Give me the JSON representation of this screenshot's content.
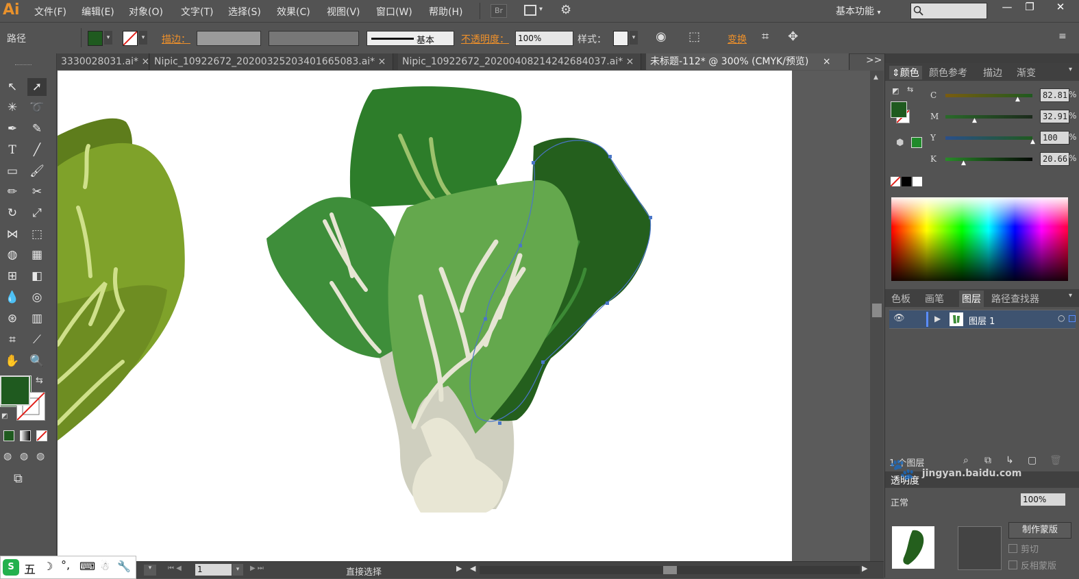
{
  "app": {
    "logo": "Ai"
  },
  "menu": {
    "items": [
      "文件(F)",
      "编辑(E)",
      "对象(O)",
      "文字(T)",
      "选择(S)",
      "效果(C)",
      "视图(V)",
      "窗口(W)",
      "帮助(H)"
    ],
    "bridge": "Br"
  },
  "workspace": {
    "label": "基本功能",
    "chevron": "▾"
  },
  "search": {
    "icon": "search-icon"
  },
  "window_controls": [
    "—",
    "❐",
    "✕"
  ],
  "controlbar": {
    "selection_type": "路径",
    "stroke_label": "描边：",
    "stroke_style": "基本",
    "opacity_label": "不透明度：",
    "opacity_value": "100%",
    "style_label": "样式：",
    "transform_label": "变换",
    "fill_color": "#1f5a1f"
  },
  "tabs": [
    {
      "label": "3330028031.ai*",
      "close": "×",
      "active": false
    },
    {
      "label": "Nipic_10922672_20200325203401665083.ai*",
      "close": "×",
      "active": false
    },
    {
      "label": "Nipic_10922672_20200408214242684037.ai*",
      "close": "×",
      "active": false
    },
    {
      "label": "未标题-112* @ 300% (CMYK/预览)",
      "close": "×",
      "active": true
    }
  ],
  "tabs_overflow": ">>",
  "color_panel": {
    "tabs": [
      "颜色",
      "颜色参考",
      "描边",
      "渐变"
    ],
    "channels": [
      {
        "name": "C",
        "value": "82.81",
        "pct": 0.8281,
        "color": "#d6a51d"
      },
      {
        "name": "M",
        "value": "32.91",
        "pct": 0.3291,
        "color": "#b14b78"
      },
      {
        "name": "Y",
        "value": "100",
        "pct": 1.0,
        "color": "#3f83b8"
      },
      {
        "name": "K",
        "value": "20.66",
        "pct": 0.2066,
        "color": "#555555"
      }
    ],
    "percent_sign": "%"
  },
  "layers_panel": {
    "tabs": [
      "色板",
      "画笔",
      "图层",
      "路径查找器"
    ],
    "layer_name": "图层 1",
    "count_text": "1 个图层"
  },
  "transparency_panel": {
    "title": "透明度",
    "blend_mode": "正常",
    "opacity": "100%",
    "make_mask": "制作蒙版",
    "clip": "剪切",
    "invert_mask": "反相蒙版"
  },
  "statusbar": {
    "page": "1",
    "tool": "直接选择"
  },
  "ime": {
    "mode": "五"
  },
  "watermark": "jingyan.baidu.com"
}
